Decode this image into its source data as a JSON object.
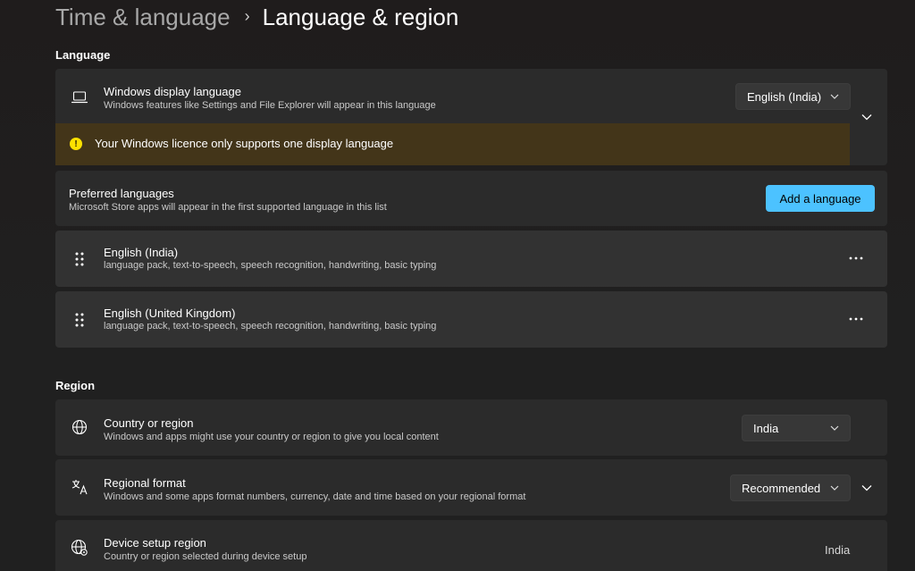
{
  "breadcrumb": {
    "parent": "Time & language",
    "separator": "›",
    "current": "Language & region"
  },
  "language_section": {
    "title": "Language",
    "display_language": {
      "title": "Windows display language",
      "subtitle": "Windows features like Settings and File Explorer will appear in this language",
      "selected": "English (India)",
      "icon": "laptop-icon"
    },
    "warning": {
      "text": "Your Windows licence only supports one display language",
      "icon": "warning-icon"
    },
    "preferred": {
      "title": "Preferred languages",
      "subtitle": "Microsoft Store apps will appear in the first supported language in this list",
      "add_button": "Add a language"
    },
    "languages": [
      {
        "name": "English (India)",
        "features": "language pack, text-to-speech, speech recognition, handwriting, basic typing"
      },
      {
        "name": "English (United Kingdom)",
        "features": "language pack, text-to-speech, speech recognition, handwriting, basic typing"
      }
    ]
  },
  "region_section": {
    "title": "Region",
    "country": {
      "title": "Country or region",
      "subtitle": "Windows and apps might use your country or region to give you local content",
      "selected": "India",
      "icon": "globe-icon"
    },
    "regional_format": {
      "title": "Regional format",
      "subtitle": "Windows and some apps format numbers, currency, date and time based on your regional format",
      "selected": "Recommended",
      "icon": "language-format-icon"
    },
    "device_setup_region": {
      "title": "Device setup region",
      "subtitle": "Country or region selected during device setup",
      "value": "India",
      "icon": "globe-setup-icon"
    }
  },
  "colors": {
    "accent": "#4cc2ff",
    "warning_bg": "#433519",
    "warning_icon": "#fce100",
    "card_bg": "#2b2b2b"
  }
}
